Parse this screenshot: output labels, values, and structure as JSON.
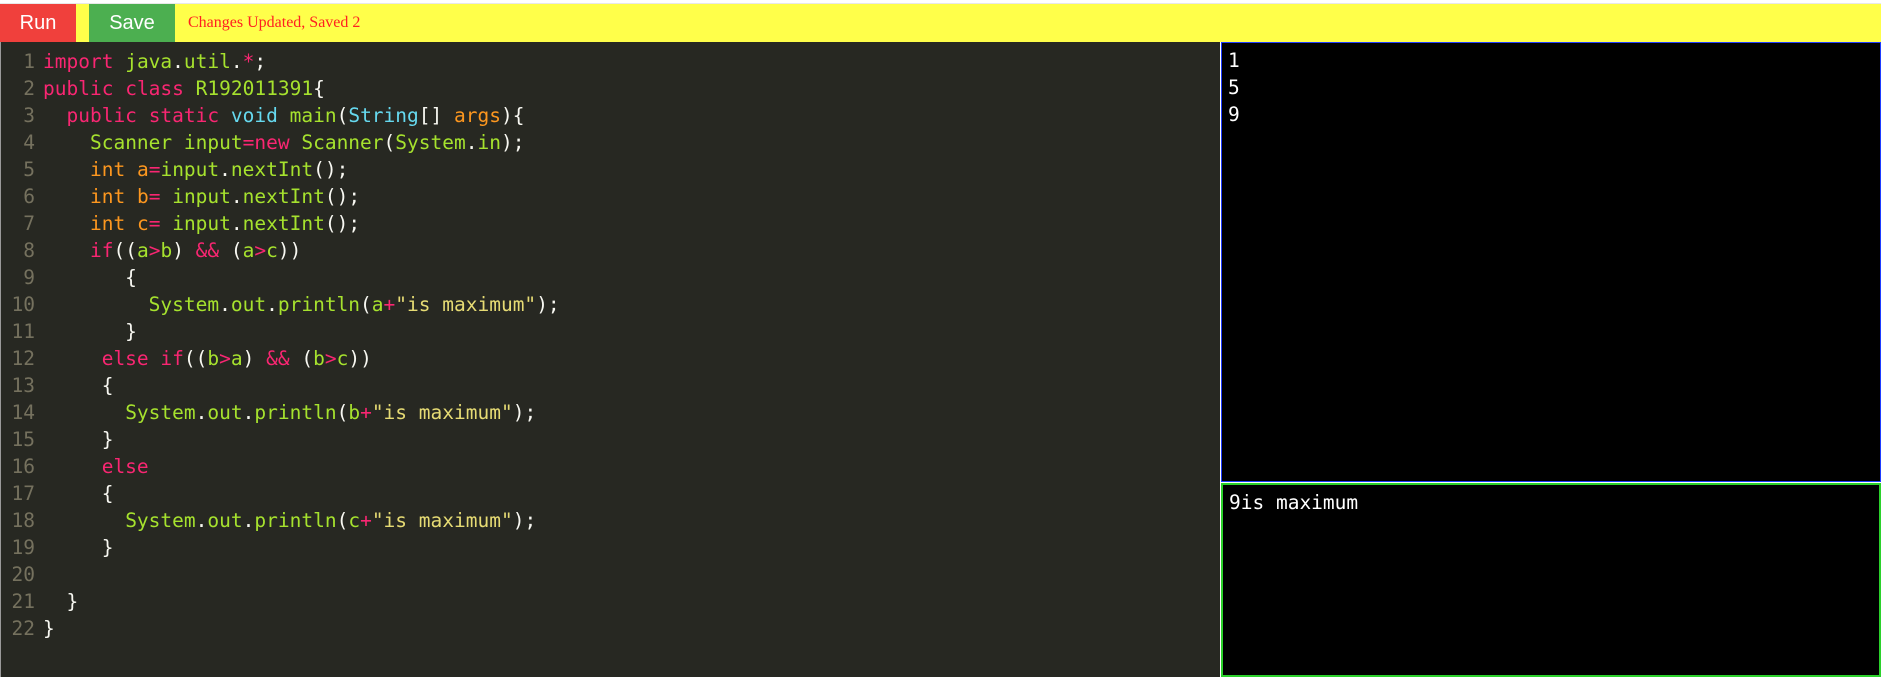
{
  "toolbar": {
    "run_label": "Run",
    "save_label": "Save",
    "status_text": "Changes Updated, Saved 2"
  },
  "colors": {
    "toolbar_bg": "#ffff4a",
    "run_button": "#f0403c",
    "save_button": "#4caf50",
    "status_text": "#ff2020",
    "editor_bg": "#272822",
    "input_border": "#1e3cff",
    "output_border": "#2bd12b"
  },
  "editor": {
    "language": "java",
    "lines": [
      {
        "n": "1",
        "tokens": [
          [
            "kw",
            "import"
          ],
          [
            "tx",
            " "
          ],
          [
            "ty2",
            "java"
          ],
          [
            "tx",
            "."
          ],
          [
            "ty2",
            "util"
          ],
          [
            "tx",
            "."
          ],
          [
            "kw",
            "*"
          ],
          [
            "tx",
            ";"
          ]
        ]
      },
      {
        "n": "2",
        "tokens": [
          [
            "kw",
            "public"
          ],
          [
            "tx",
            " "
          ],
          [
            "kw",
            "class"
          ],
          [
            "tx",
            " "
          ],
          [
            "fn",
            "R192011391"
          ],
          [
            "tx",
            "{"
          ]
        ]
      },
      {
        "n": "3",
        "tokens": [
          [
            "tx",
            "  "
          ],
          [
            "kw",
            "public"
          ],
          [
            "tx",
            " "
          ],
          [
            "kw",
            "static"
          ],
          [
            "tx",
            " "
          ],
          [
            "ty",
            "void"
          ],
          [
            "tx",
            " "
          ],
          [
            "fn",
            "main"
          ],
          [
            "tx",
            "("
          ],
          [
            "ty",
            "String"
          ],
          [
            "tx",
            "[] "
          ],
          [
            "pa",
            "args"
          ],
          [
            "tx",
            "){"
          ]
        ]
      },
      {
        "n": "4",
        "tokens": [
          [
            "tx",
            "    "
          ],
          [
            "ty2",
            "Scanner"
          ],
          [
            "tx",
            " "
          ],
          [
            "ty2",
            "input"
          ],
          [
            "kw",
            "="
          ],
          [
            "kw",
            "new"
          ],
          [
            "tx",
            " "
          ],
          [
            "fn",
            "Scanner"
          ],
          [
            "tx",
            "("
          ],
          [
            "ty2",
            "System"
          ],
          [
            "tx",
            "."
          ],
          [
            "ty2",
            "in"
          ],
          [
            "tx",
            ");"
          ]
        ]
      },
      {
        "n": "5",
        "tokens": [
          [
            "tx",
            "    "
          ],
          [
            "pa",
            "int"
          ],
          [
            "tx",
            " "
          ],
          [
            "pa",
            "a"
          ],
          [
            "kw",
            "="
          ],
          [
            "ty2",
            "input"
          ],
          [
            "tx",
            "."
          ],
          [
            "fn",
            "nextInt"
          ],
          [
            "tx",
            "();"
          ]
        ]
      },
      {
        "n": "6",
        "tokens": [
          [
            "tx",
            "    "
          ],
          [
            "pa",
            "int"
          ],
          [
            "tx",
            " "
          ],
          [
            "pa",
            "b"
          ],
          [
            "kw",
            "="
          ],
          [
            "tx",
            " "
          ],
          [
            "ty2",
            "input"
          ],
          [
            "tx",
            "."
          ],
          [
            "fn",
            "nextInt"
          ],
          [
            "tx",
            "();"
          ]
        ]
      },
      {
        "n": "7",
        "tokens": [
          [
            "tx",
            "    "
          ],
          [
            "pa",
            "int"
          ],
          [
            "tx",
            " "
          ],
          [
            "pa",
            "c"
          ],
          [
            "kw",
            "="
          ],
          [
            "tx",
            " "
          ],
          [
            "ty2",
            "input"
          ],
          [
            "tx",
            "."
          ],
          [
            "fn",
            "nextInt"
          ],
          [
            "tx",
            "();"
          ]
        ]
      },
      {
        "n": "8",
        "tokens": [
          [
            "tx",
            "    "
          ],
          [
            "kw",
            "if"
          ],
          [
            "tx",
            "(("
          ],
          [
            "ty2",
            "a"
          ],
          [
            "kw",
            ">"
          ],
          [
            "ty2",
            "b"
          ],
          [
            "tx",
            ") "
          ],
          [
            "kw",
            "&&"
          ],
          [
            "tx",
            " ("
          ],
          [
            "ty2",
            "a"
          ],
          [
            "kw",
            ">"
          ],
          [
            "ty2",
            "c"
          ],
          [
            "tx",
            "))"
          ]
        ]
      },
      {
        "n": "9",
        "tokens": [
          [
            "tx",
            "       {"
          ]
        ]
      },
      {
        "n": "10",
        "tokens": [
          [
            "tx",
            "         "
          ],
          [
            "ty2",
            "System"
          ],
          [
            "tx",
            "."
          ],
          [
            "ty2",
            "out"
          ],
          [
            "tx",
            "."
          ],
          [
            "fn",
            "println"
          ],
          [
            "tx",
            "("
          ],
          [
            "ty2",
            "a"
          ],
          [
            "kw",
            "+"
          ],
          [
            "st",
            "\"is maximum\""
          ],
          [
            "tx",
            ");"
          ]
        ]
      },
      {
        "n": "11",
        "tokens": [
          [
            "tx",
            "       }"
          ]
        ]
      },
      {
        "n": "12",
        "tokens": [
          [
            "tx",
            "     "
          ],
          [
            "kw",
            "else"
          ],
          [
            "tx",
            " "
          ],
          [
            "kw",
            "if"
          ],
          [
            "tx",
            "(("
          ],
          [
            "ty2",
            "b"
          ],
          [
            "kw",
            ">"
          ],
          [
            "ty2",
            "a"
          ],
          [
            "tx",
            ") "
          ],
          [
            "kw",
            "&&"
          ],
          [
            "tx",
            " ("
          ],
          [
            "ty2",
            "b"
          ],
          [
            "kw",
            ">"
          ],
          [
            "ty2",
            "c"
          ],
          [
            "tx",
            "))"
          ]
        ]
      },
      {
        "n": "13",
        "tokens": [
          [
            "tx",
            "     {"
          ]
        ]
      },
      {
        "n": "14",
        "tokens": [
          [
            "tx",
            "       "
          ],
          [
            "ty2",
            "System"
          ],
          [
            "tx",
            "."
          ],
          [
            "ty2",
            "out"
          ],
          [
            "tx",
            "."
          ],
          [
            "fn",
            "println"
          ],
          [
            "tx",
            "("
          ],
          [
            "ty2",
            "b"
          ],
          [
            "kw",
            "+"
          ],
          [
            "st",
            "\"is maximum\""
          ],
          [
            "tx",
            ");"
          ]
        ]
      },
      {
        "n": "15",
        "tokens": [
          [
            "tx",
            "     }"
          ]
        ]
      },
      {
        "n": "16",
        "tokens": [
          [
            "tx",
            "     "
          ],
          [
            "kw",
            "else"
          ]
        ]
      },
      {
        "n": "17",
        "tokens": [
          [
            "tx",
            "     {"
          ]
        ]
      },
      {
        "n": "18",
        "tokens": [
          [
            "tx",
            "       "
          ],
          [
            "ty2",
            "System"
          ],
          [
            "tx",
            "."
          ],
          [
            "ty2",
            "out"
          ],
          [
            "tx",
            "."
          ],
          [
            "fn",
            "println"
          ],
          [
            "tx",
            "("
          ],
          [
            "ty2",
            "c"
          ],
          [
            "kw",
            "+"
          ],
          [
            "st",
            "\"is maximum\""
          ],
          [
            "tx",
            ");"
          ]
        ]
      },
      {
        "n": "19",
        "tokens": [
          [
            "tx",
            "     }"
          ]
        ]
      },
      {
        "n": "20",
        "tokens": []
      },
      {
        "n": "21",
        "tokens": [
          [
            "tx",
            "  }"
          ]
        ]
      },
      {
        "n": "22",
        "tokens": [
          [
            "tx",
            "}"
          ]
        ]
      }
    ]
  },
  "input_pane": {
    "text": "1\n5\n9"
  },
  "output_pane": {
    "text": "9is maximum"
  }
}
